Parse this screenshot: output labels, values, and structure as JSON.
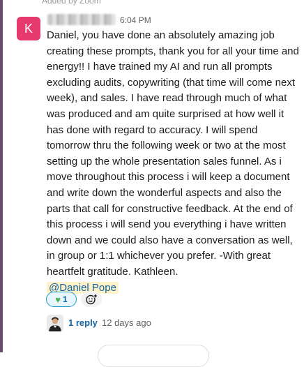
{
  "header_fragment": "Added by Zoom",
  "message": {
    "avatar_letter": "K",
    "time": "6:04 PM",
    "body": "Daniel, you have done an absolutely amazing job creating these prompts, thank you for all your time and energy!! I have trained my AI and run all prompts excluding audits, copywriting (that time will come next week), and sales. I have read through much of what was produced and am quite surprised at how well it has done with regard to accuracy. I will spend tomorrow thru the following week or two at the most setting up the whole presentation sales funnel. As i move throughout this process i will keep a document and write down the wonderful aspects and also the parts that call for constructive feedback. At the end of this process i will send you everything i have written down and we could also have a conversation as well, in group or 1:1 whichever you prefer. -With great heartfelt gratitude. Kathleen.",
    "mention": "@Daniel Pope"
  },
  "reactions": [
    {
      "icon": "green-heart-icon",
      "count": "1"
    }
  ],
  "thread": {
    "reply_label": "1 reply",
    "age": "12 days ago"
  },
  "colors": {
    "avatar_bg": "#e63a6f",
    "link": "#1264a3",
    "mention_bg": "#fdf1c7",
    "sidebar_rule": "#6b4a6e"
  }
}
